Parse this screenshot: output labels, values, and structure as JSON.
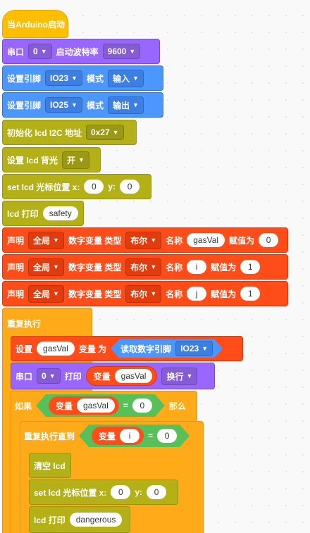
{
  "hat": {
    "label": "当Arduino启动"
  },
  "serial": {
    "label": "串口",
    "port": "0",
    "baud_label": "启动波特率",
    "baud": "9600"
  },
  "pin1": {
    "label": "设置引脚",
    "pin": "IO23",
    "mode_label": "模式",
    "mode": "输入"
  },
  "pin2": {
    "label": "设置引脚",
    "pin": "IO25",
    "mode_label": "模式",
    "mode": "输出"
  },
  "lcd_init": {
    "label": "初始化 lcd I2C 地址",
    "addr": "0x27"
  },
  "lcd_backlight": {
    "label": "设置 lcd 背光",
    "state": "开"
  },
  "lcd_cursor1": {
    "label": "set lcd 光标位置 x:",
    "x": "0",
    "y_label": "y:",
    "y": "0"
  },
  "lcd_print1": {
    "label": "lcd 打印",
    "text": "safety"
  },
  "decl": [
    {
      "label": "声明",
      "scope": "全局",
      "type_label": "数字变量 类型",
      "type": "布尔",
      "name_label": "名称",
      "name": "gasVal",
      "init_label": "赋值为",
      "init": "0"
    },
    {
      "label": "声明",
      "scope": "全局",
      "type_label": "数字变量 类型",
      "type": "布尔",
      "name_label": "名称",
      "name": "i",
      "init_label": "赋值为",
      "init": "1"
    },
    {
      "label": "声明",
      "scope": "全局",
      "type_label": "数字变量 类型",
      "type": "布尔",
      "name_label": "名称",
      "name": "j",
      "init_label": "赋值为",
      "init": "1"
    }
  ],
  "loop": {
    "label": "重复执行"
  },
  "set_var": {
    "label": "设置",
    "var": "gasVal",
    "as_label": "变量 为",
    "read_label": "读取数字引脚",
    "pin": "IO23"
  },
  "serial_print": {
    "label": "串口",
    "port": "0",
    "print_label": "打印",
    "var_label": "变量",
    "var": "gasVal",
    "newline": "换行"
  },
  "if_block": {
    "label": "如果",
    "var_label": "变量",
    "var": "gasVal",
    "op": "=",
    "value": "0",
    "then_label": "那么"
  },
  "repeat_until": {
    "label": "重复执行直到",
    "var_label": "变量",
    "var": "i",
    "op": "=",
    "value": "0"
  },
  "lcd_clear": {
    "label": "清空 lcd"
  },
  "lcd_cursor2": {
    "label": "set lcd 光标位置 x:",
    "x": "0",
    "y_label": "y:",
    "y": "0"
  },
  "lcd_print2": {
    "label": "lcd 打印",
    "text": "dangerous"
  },
  "colors": {
    "events": "#f5b400",
    "serial": "#9966ff",
    "pins": "#4c97ff",
    "lcd": "#b3b117",
    "variables": "#ff4d1a",
    "control": "#ffab19"
  }
}
